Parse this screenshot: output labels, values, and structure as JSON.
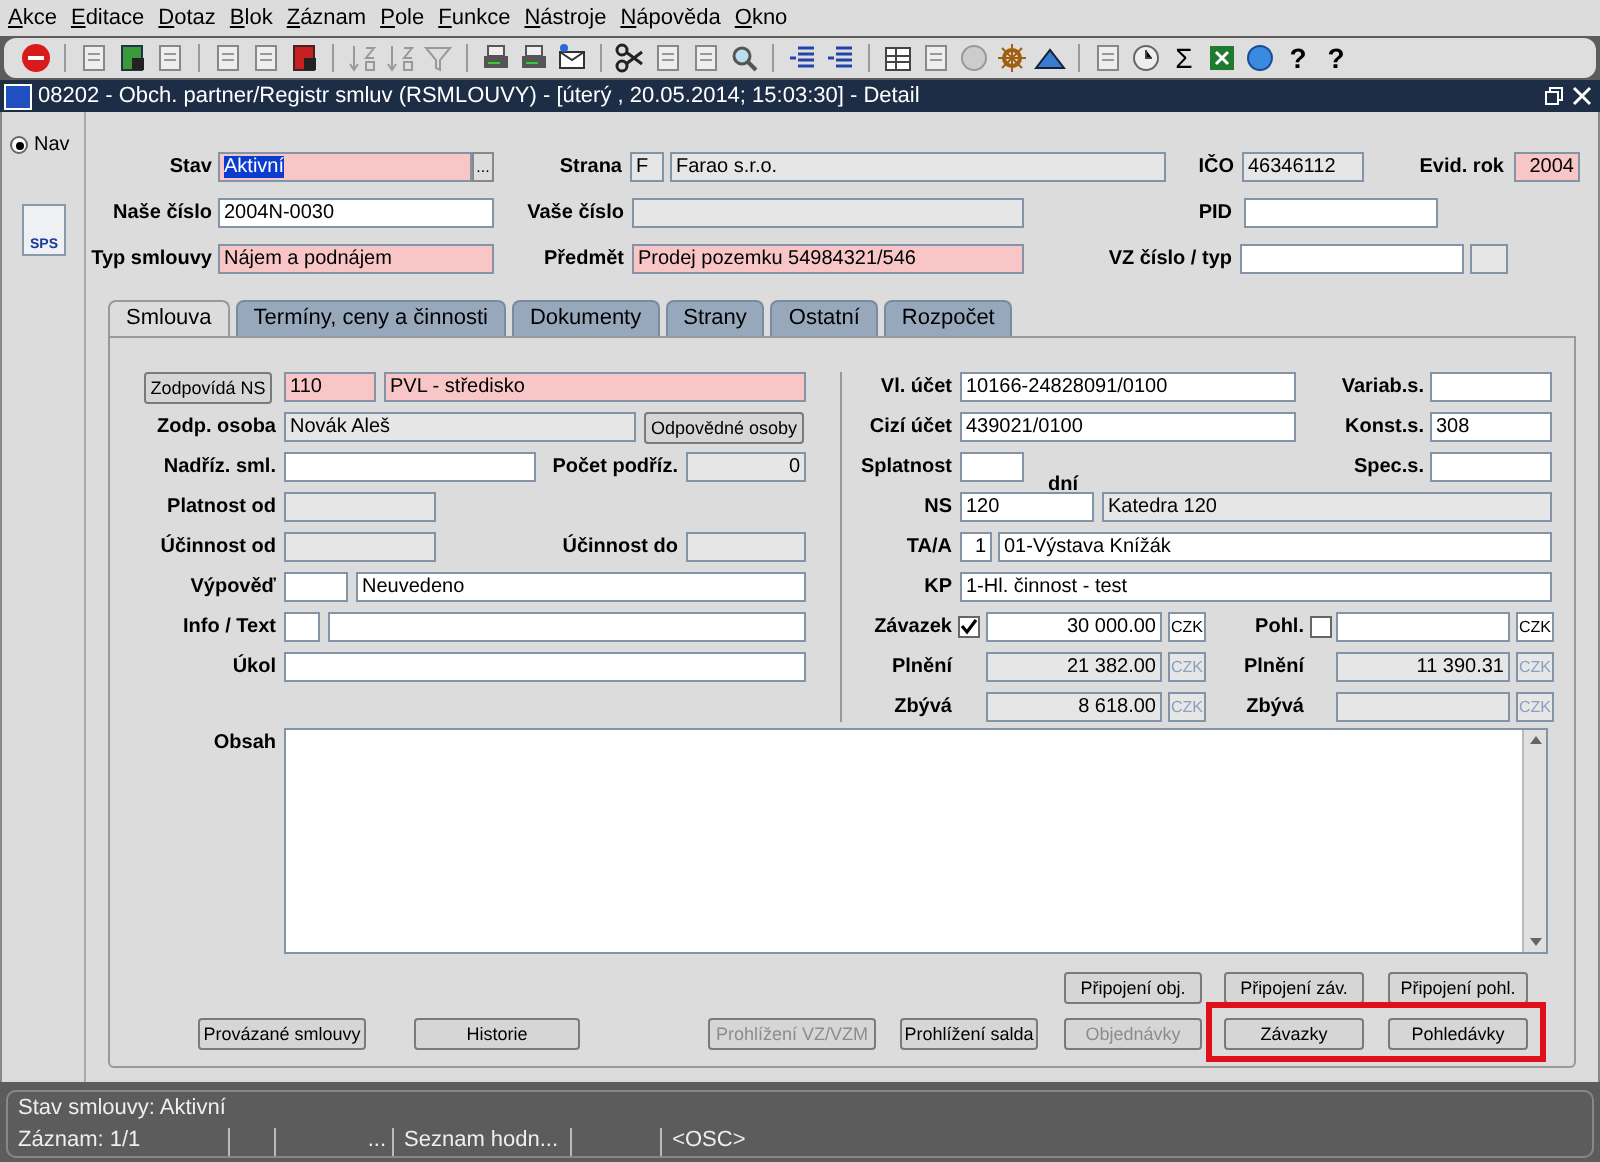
{
  "menu": [
    "Akce",
    "Editace",
    "Dotaz",
    "Blok",
    "Záznam",
    "Pole",
    "Funkce",
    "Nástroje",
    "Nápověda",
    "Okno"
  ],
  "toolbar": {
    "sum": "Σ",
    "help": [
      "?",
      "?"
    ]
  },
  "window": {
    "title": "08202 - Obch. partner/Registr smluv (RSMLOUVY) - [úterý  , 20.05.2014; 15:03:30] - Detail"
  },
  "nav": {
    "label": "Nav",
    "selected": true,
    "button": "SPS"
  },
  "header": {
    "stav": {
      "label": "Stav",
      "value": "Aktivní",
      "kind": "required",
      "text_selected": true
    },
    "stav_list": "...",
    "strana": {
      "label": "Strana",
      "value": "Farao s.r.o.",
      "kind": "readonly"
    },
    "strana_code": {
      "value": "F",
      "kind": "readonly"
    },
    "ico": {
      "label": "IČO",
      "value": "46346112",
      "kind": "readonly"
    },
    "evid_rok": {
      "label": "Evid. rok",
      "value": "2004",
      "kind": "required"
    },
    "nase_cislo": {
      "label": "Naše číslo",
      "value": "2004N-0030",
      "kind": "editable"
    },
    "vase_cislo": {
      "label": "Vaše číslo",
      "kind": "readonly"
    },
    "pid": {
      "label": "PID",
      "kind": "editable"
    },
    "typ_smlouvy": {
      "label": "Typ smlouvy",
      "value": "Nájem a podnájem",
      "kind": "required"
    },
    "predmet": {
      "label": "Předmět",
      "value": "Prodej pozemku 54984321/546",
      "kind": "required"
    },
    "vz_cislo": {
      "label": "VZ číslo / typ",
      "kind": "editable"
    },
    "vz_typ": {
      "kind": "readonly"
    }
  },
  "tabs": [
    {
      "label": "Smlouva",
      "selected": true
    },
    {
      "label": "Termíny, ceny a činnosti",
      "selected": false
    },
    {
      "label": "Dokumenty",
      "selected": false
    },
    {
      "label": "Strany",
      "selected": false
    },
    {
      "label": "Ostatní",
      "selected": false
    },
    {
      "label": "Rozpočet",
      "selected": false
    }
  ],
  "left": {
    "ns_button": "Zodpovídá NS",
    "ns_code": {
      "value": "110",
      "kind": "required"
    },
    "ns_name": {
      "value": "PVL - středisko",
      "kind": "required"
    },
    "osoba": {
      "label": "Zodp. osoba",
      "value": "Novák Aleš",
      "kind": "readonly"
    },
    "osoby_button": "Odpovědné osoby",
    "nadriz": {
      "label": "Nadříz. sml.",
      "kind": "editable"
    },
    "pocet": {
      "label": "Počet podříz.",
      "value": "0",
      "kind": "readonly"
    },
    "platnost_od": {
      "label": "Platnost od",
      "kind": "readonly"
    },
    "ucinnost_od": {
      "label": "Účinnost od",
      "kind": "readonly"
    },
    "ucinnost_do": {
      "label": "Účinnost do",
      "kind": "readonly"
    },
    "vypoved": {
      "label": "Výpověď",
      "kind": "editable"
    },
    "vypoved_text": {
      "value": "Neuvedeno",
      "kind": "editable"
    },
    "info": {
      "label": "Info / Text",
      "kind": "editable"
    },
    "info_text": {
      "kind": "editable"
    },
    "ukol": {
      "label": "Úkol",
      "kind": "editable"
    }
  },
  "right": {
    "vl_ucet": {
      "label": "Vl. účet",
      "value": "10166-24828091/0100",
      "kind": "editable"
    },
    "variab": {
      "label": "Variab.s.",
      "kind": "editable"
    },
    "cizi_ucet": {
      "label": "Cizí účet",
      "value": "439021/0100",
      "kind": "editable"
    },
    "konst": {
      "label": "Konst.s.",
      "value": "308",
      "kind": "editable"
    },
    "splatnost": {
      "label": "Splatnost",
      "kind": "editable"
    },
    "dni": "dní",
    "spec": {
      "label": "Spec.s.",
      "kind": "editable"
    },
    "ns": {
      "label": "NS",
      "value": "120",
      "kind": "editable"
    },
    "ns_name": {
      "value": "Katedra 120",
      "kind": "readonly"
    },
    "taa": {
      "label": "TA/A",
      "value": "1",
      "kind": "editable"
    },
    "taa_name": {
      "value": "01-Výstava Knížák",
      "kind": "editable"
    },
    "kp": {
      "label": "KP",
      "value": "1-Hl. činnost - test",
      "kind": "editable"
    },
    "zavazek": {
      "label": "Závazek",
      "checked": true,
      "value": "30 000.00",
      "kind": "editable"
    },
    "zavazek_currency": {
      "value": "CZK",
      "kind": "editable"
    },
    "pohl": {
      "label": "Pohl.",
      "checked": false,
      "kind": "editable"
    },
    "pohl_currency": {
      "value": "CZK",
      "kind": "editable"
    },
    "plneni_left": {
      "label": "Plnění",
      "value": "21 382.00",
      "kind": "readonly"
    },
    "plneni_left_currency": {
      "value": "CZK",
      "kind": "disabled"
    },
    "plneni_right": {
      "label": "Plnění",
      "value": "11 390.31",
      "kind": "readonly"
    },
    "plneni_right_currency": {
      "value": "CZK",
      "kind": "disabled"
    },
    "zbyva_left": {
      "label": "Zbývá",
      "value": "8 618.00",
      "kind": "readonly"
    },
    "zbyva_left_currency": {
      "value": "CZK",
      "kind": "disabled"
    },
    "zbyva_right": {
      "label": "Zbývá",
      "kind": "readonly"
    },
    "zbyva_right_currency": {
      "value": "CZK",
      "kind": "disabled"
    }
  },
  "obsah": {
    "label": "Obsah",
    "kind": "editable"
  },
  "buttons_top": [
    {
      "label": "Připojení obj.",
      "disabled": false
    },
    {
      "label": "Připojení záv.",
      "disabled": false
    },
    {
      "label": "Připojení pohl.",
      "disabled": false
    }
  ],
  "buttons_bottom": [
    {
      "label": "Provázané smlouvy",
      "disabled": false
    },
    {
      "label": "Historie",
      "disabled": false
    },
    {
      "label": "Prohlížení VZ/VZM",
      "disabled": true
    },
    {
      "label": "Prohlížení salda",
      "disabled": false
    },
    {
      "label": "Objednávky",
      "disabled": true
    }
  ],
  "buttons_framed": [
    {
      "label": "Závazky",
      "disabled": false
    },
    {
      "label": "Pohledávky",
      "disabled": false
    }
  ],
  "status": {
    "message": "Stav smlouvy: Aktivní",
    "record": "Záznam: 1/1",
    "ellipsis": "...",
    "list": "Seznam hodn...",
    "mode": "<OSC>"
  }
}
